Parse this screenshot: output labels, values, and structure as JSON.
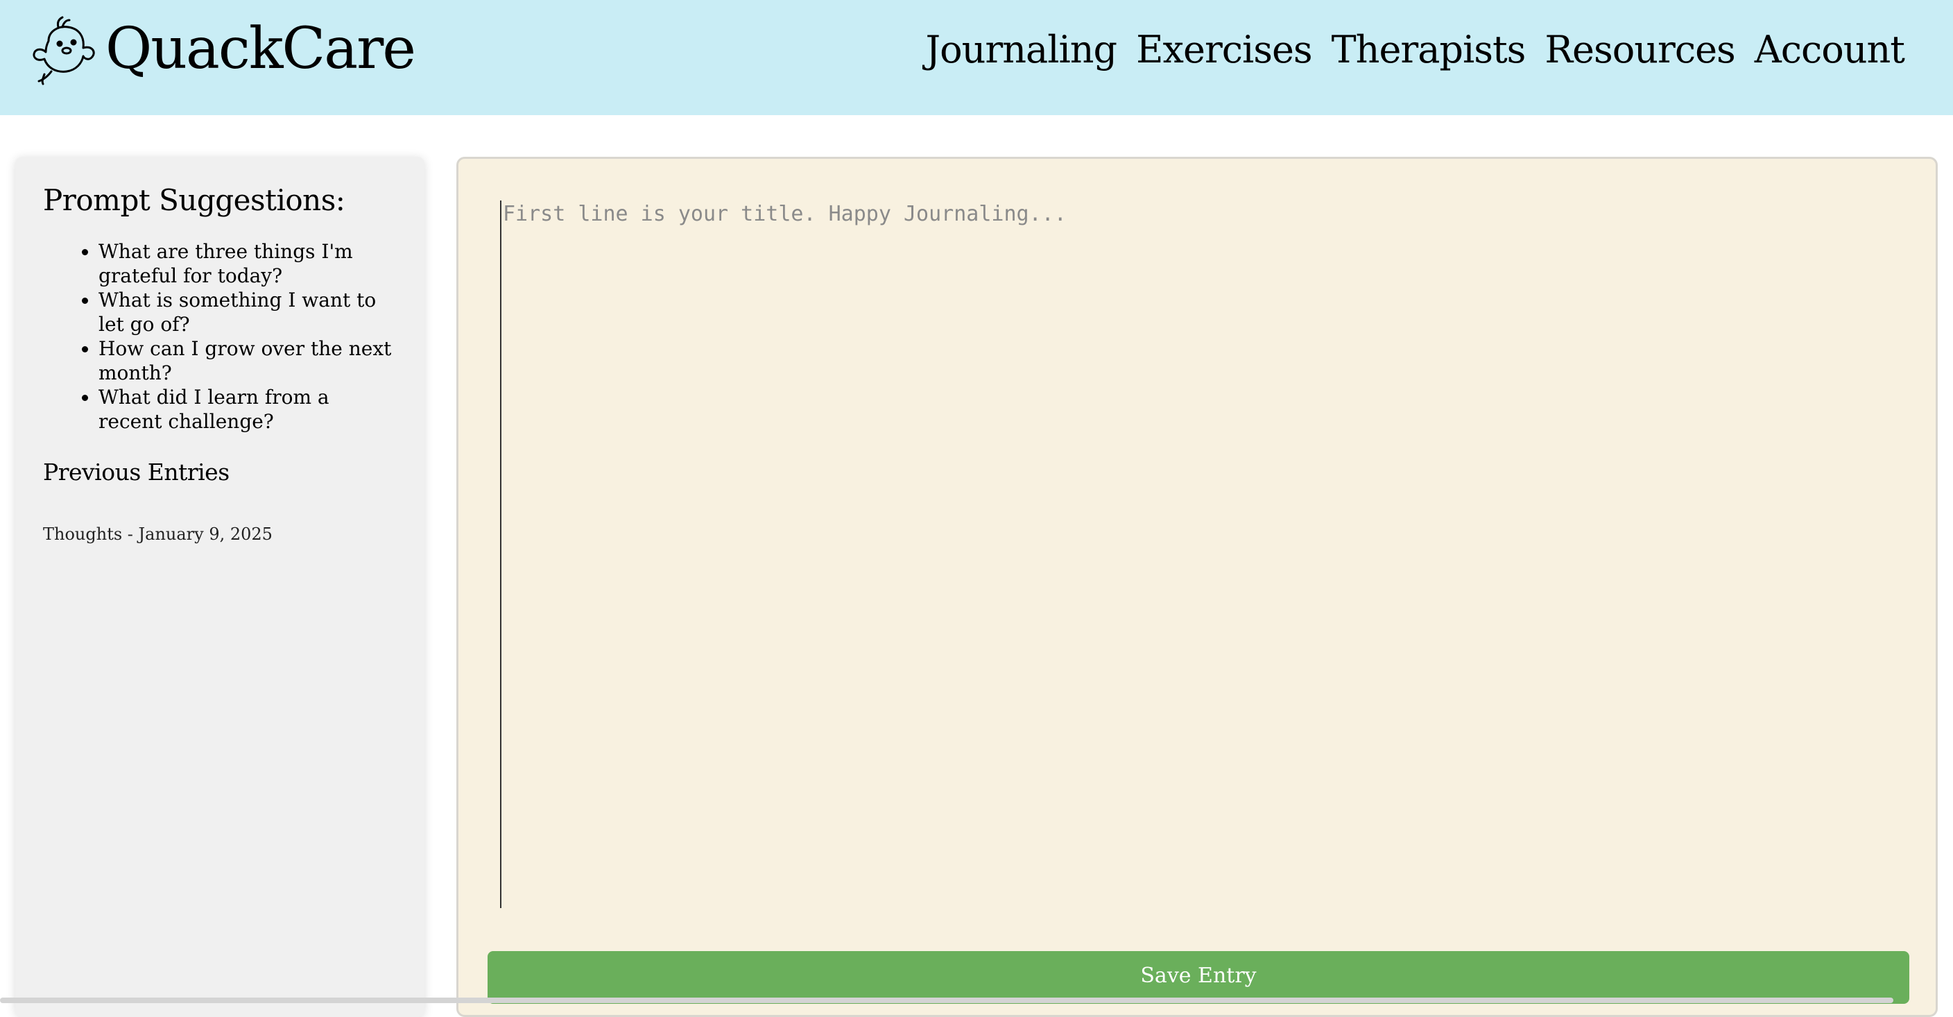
{
  "header": {
    "brand": "QuackCare",
    "nav": [
      "Journaling",
      "Exercises",
      "Therapists",
      "Resources",
      "Account"
    ]
  },
  "sidebar": {
    "prompts_title": "Prompt Suggestions:",
    "prompts": [
      "What are three things I'm grateful for today?",
      "What is something I want to let go of?",
      "How can I grow over the next month?",
      "What did I learn from a recent challenge?"
    ],
    "previous_title": "Previous Entries",
    "entries": [
      "Thoughts - January 9, 2025"
    ]
  },
  "editor": {
    "placeholder": "First line is your title. Happy Journaling...",
    "value": "",
    "save_label": "Save Entry"
  },
  "colors": {
    "header_bg": "#c9edf5",
    "sidebar_bg": "#f0f0f0",
    "editor_bg": "#f8f1e0",
    "save_button": "#6aaf5b"
  },
  "icons": {
    "logo": "duck-logo-icon"
  }
}
